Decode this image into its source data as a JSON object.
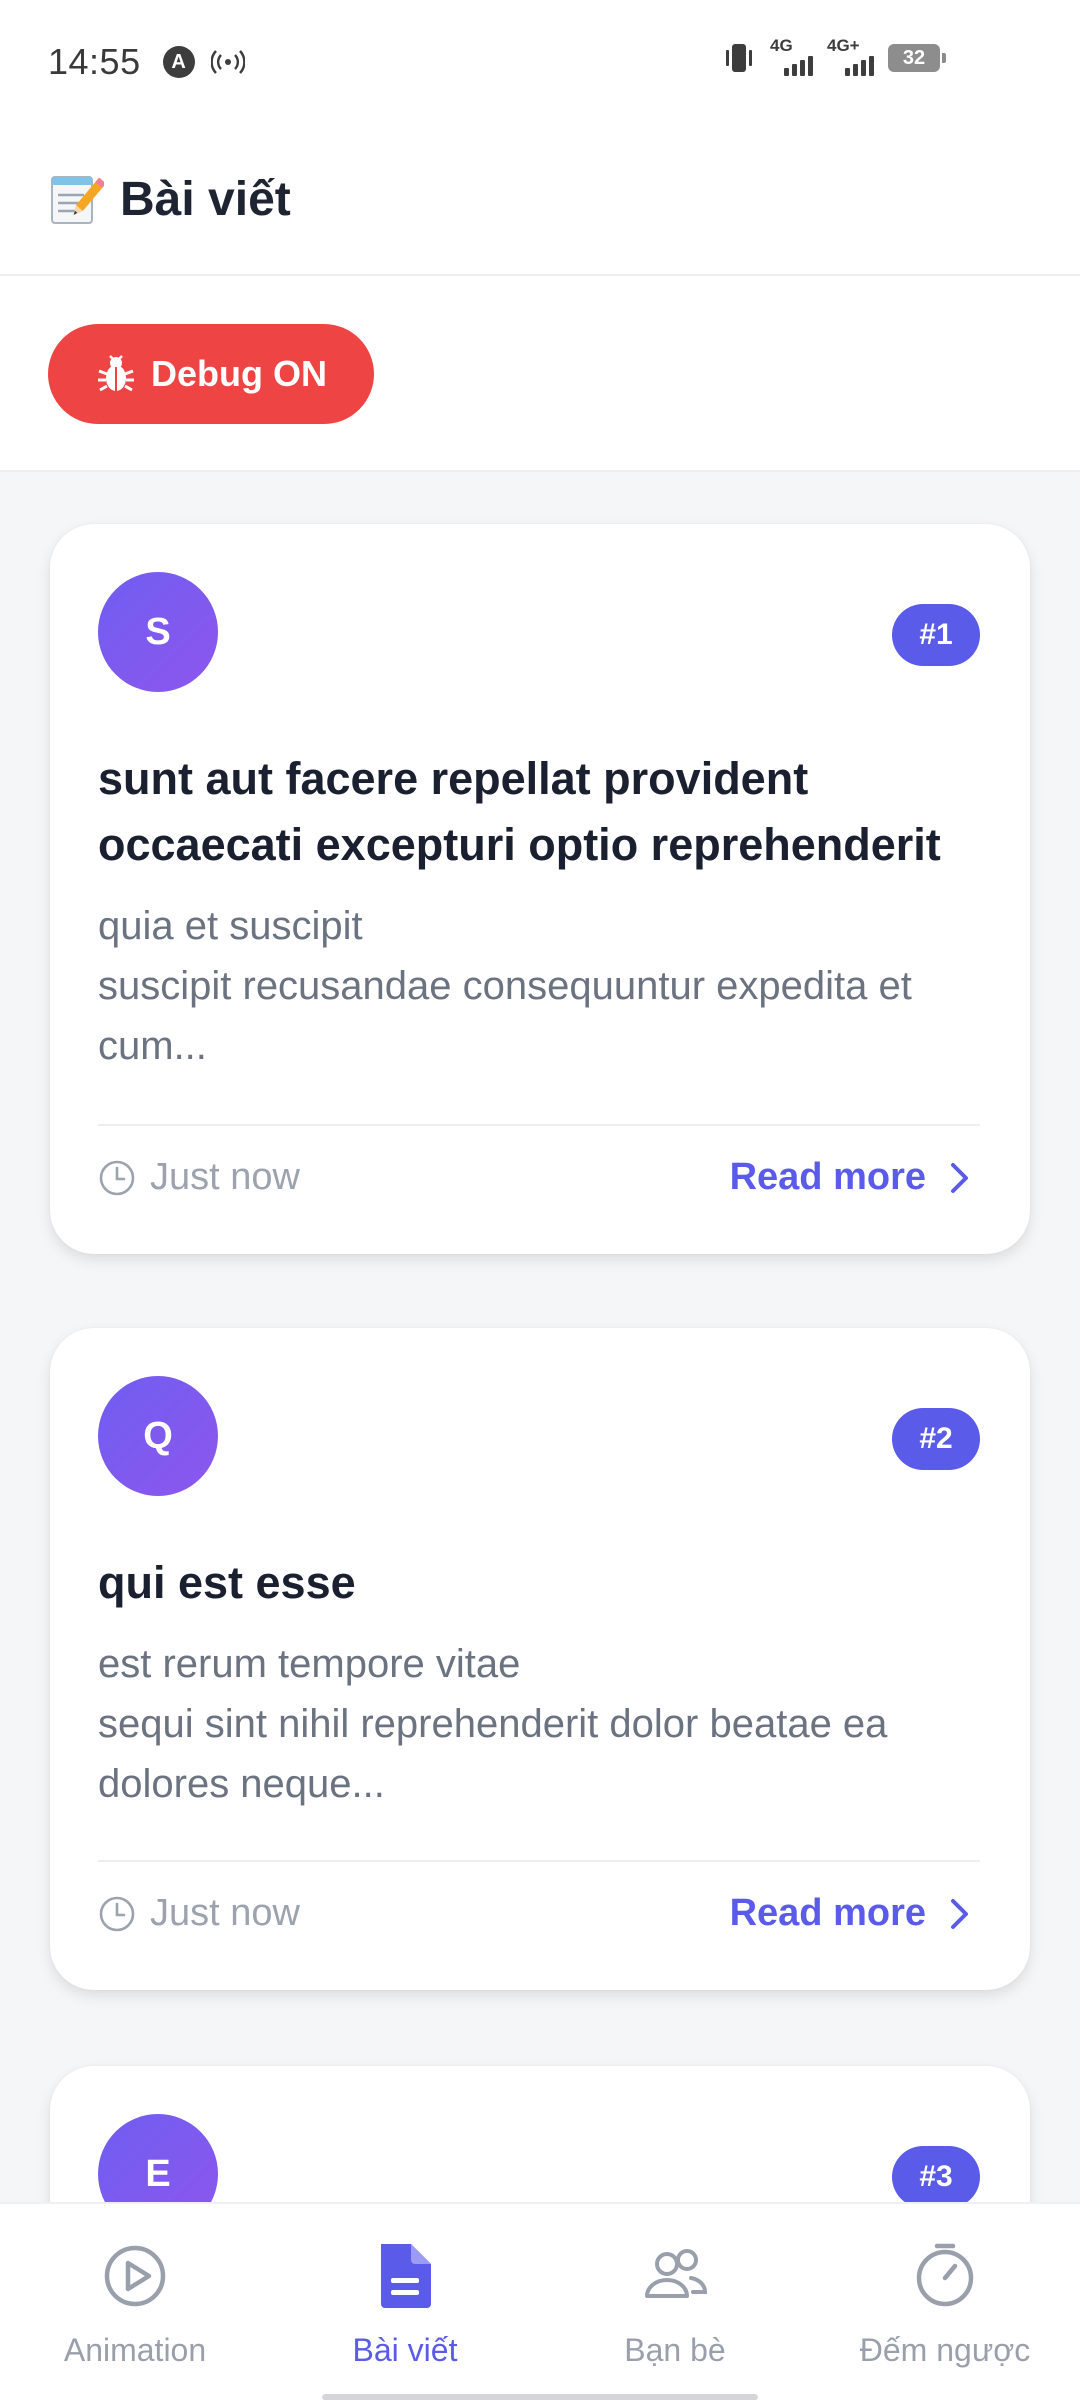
{
  "status_bar": {
    "time": "14:55",
    "app_icon_letter": "A",
    "network_1": "4G",
    "network_2": "4G+",
    "battery": "32"
  },
  "header": {
    "icon": "memo-icon",
    "title": "Bài viết"
  },
  "debug": {
    "label": "Debug ON",
    "icon": "bug-icon",
    "color": "#ef4444"
  },
  "posts": [
    {
      "avatar_letter": "S",
      "badge": "#1",
      "title": "sunt aut facere repellat provident occaecati excepturi optio reprehenderit",
      "body": "quia et suscipit\nsuscipit recusandae consequuntur expedita et cum...",
      "time": "Just now",
      "read_more": "Read more"
    },
    {
      "avatar_letter": "Q",
      "badge": "#2",
      "title": "qui est esse",
      "body": "est rerum tempore vitae\nsequi sint nihil reprehenderit dolor beatae ea dolores neque...",
      "time": "Just now",
      "read_more": "Read more"
    },
    {
      "avatar_letter": "E",
      "badge": "#3"
    }
  ],
  "bottom_nav": {
    "items": [
      {
        "label": "Animation",
        "icon": "play-circle-icon",
        "active": false
      },
      {
        "label": "Bài viết",
        "icon": "document-icon",
        "active": true
      },
      {
        "label": "Bạn bè",
        "icon": "users-icon",
        "active": false
      },
      {
        "label": "Đếm ngược",
        "icon": "timer-icon",
        "active": false
      }
    ]
  },
  "colors": {
    "accent": "#5b5bea",
    "avatar_gradient_start": "#6f5ef0",
    "avatar_gradient_end": "#8e56ee",
    "inactive": "#9aa0ab"
  }
}
